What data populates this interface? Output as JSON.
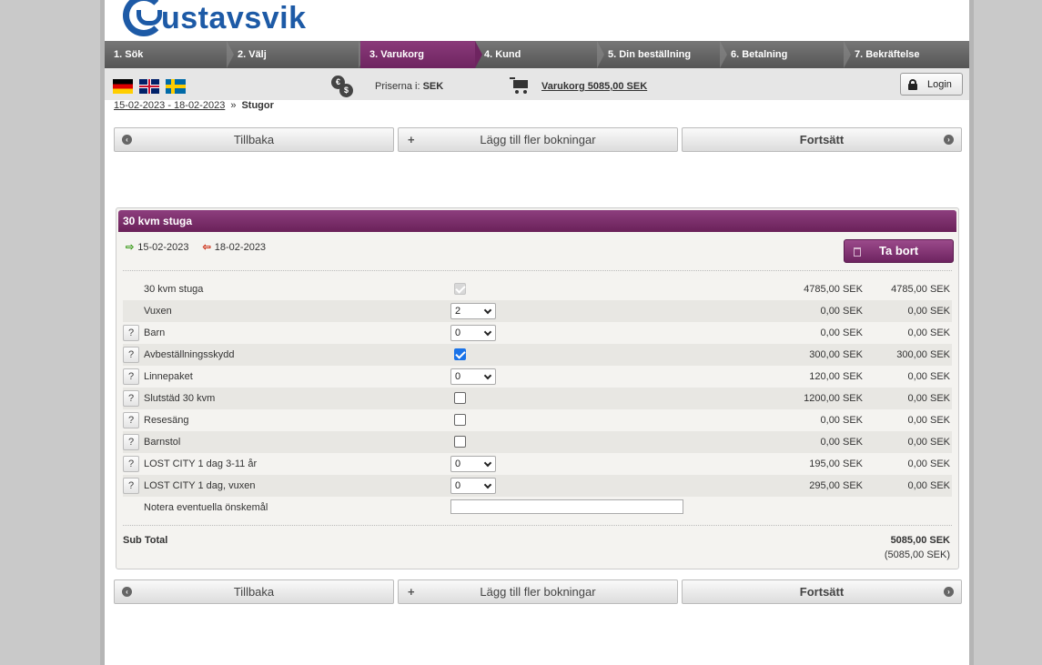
{
  "brand": {
    "logo_text": "ustavsvik",
    "primary_color": "#1d5aa6",
    "accent_color": "#7a2a6c"
  },
  "steps": [
    "1. Sök",
    "2. Välj",
    "3. Varukorg",
    "4. Kund",
    "5. Din beställning",
    "6. Betalning",
    "7. Bekräftelse"
  ],
  "active_step": "3. Varukorg",
  "infobar": {
    "prices_label": "Priserna i:",
    "currency": "SEK",
    "cart_link": "Varukorg 5085,00 SEK",
    "login_label": "Login"
  },
  "breadcrumb": {
    "dates_link": "15-02-2023 - 18-02-2023",
    "separator": "»",
    "current": "Stugor"
  },
  "nav": {
    "back": "Tillbaka",
    "add_more": "Lägg till fler bokningar",
    "continue": "Fortsätt"
  },
  "booking": {
    "title": "30 kvm stuga",
    "arrival": "15-02-2023",
    "departure": "18-02-2023",
    "remove_label": "Ta bort",
    "items": [
      {
        "name": "30 kvm stuga",
        "help": false,
        "control": "checkbox-disabled",
        "value": "",
        "price": "4785,00 SEK",
        "total": "4785,00 SEK"
      },
      {
        "name": "Vuxen",
        "help": false,
        "control": "select",
        "value": "2",
        "price": "0,00 SEK",
        "total": "0,00 SEK"
      },
      {
        "name": "Barn",
        "help": true,
        "control": "select",
        "value": "0",
        "price": "0,00 SEK",
        "total": "0,00 SEK"
      },
      {
        "name": "Avbeställningsskydd",
        "help": true,
        "control": "checkbox-checked",
        "value": "",
        "price": "300,00 SEK",
        "total": "300,00 SEK"
      },
      {
        "name": "Linnepaket",
        "help": true,
        "control": "select",
        "value": "0",
        "price": "120,00 SEK",
        "total": "0,00 SEK"
      },
      {
        "name": "Slutstäd 30 kvm",
        "help": true,
        "control": "checkbox",
        "value": "",
        "price": "1200,00 SEK",
        "total": "0,00 SEK"
      },
      {
        "name": "Resesäng",
        "help": true,
        "control": "checkbox",
        "value": "",
        "price": "0,00 SEK",
        "total": "0,00 SEK"
      },
      {
        "name": "Barnstol",
        "help": true,
        "control": "checkbox",
        "value": "",
        "price": "0,00 SEK",
        "total": "0,00 SEK"
      },
      {
        "name": "LOST CITY 1 dag 3-11 år",
        "help": true,
        "control": "select",
        "value": "0",
        "price": "195,00 SEK",
        "total": "0,00 SEK"
      },
      {
        "name": "LOST CITY 1 dag, vuxen",
        "help": true,
        "control": "select",
        "value": "0",
        "price": "295,00 SEK",
        "total": "0,00 SEK"
      },
      {
        "name": "Notera eventuella önskemål",
        "help": false,
        "control": "text",
        "value": "",
        "price": "",
        "total": ""
      }
    ],
    "help_label": "?",
    "subtotal_label": "Sub Total",
    "subtotal": "5085,00 SEK",
    "subtotal_secondary": "(5085,00 SEK)"
  }
}
